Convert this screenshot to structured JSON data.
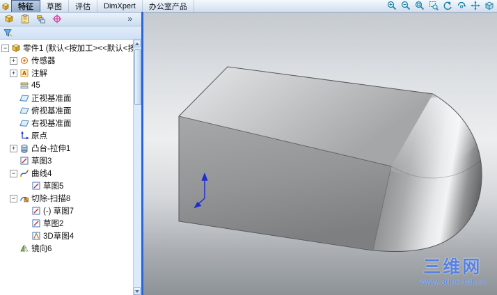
{
  "header": {
    "tabs": [
      {
        "label": "特征"
      },
      {
        "label": "草图"
      },
      {
        "label": "评估"
      },
      {
        "label": "DimXpert"
      },
      {
        "label": "办公室产品"
      }
    ],
    "active_tab": "特征",
    "view_tools": [
      {
        "name": "zoom-in"
      },
      {
        "name": "zoom-out"
      },
      {
        "name": "zoom-to-fit"
      },
      {
        "name": "zoom-to-area"
      },
      {
        "name": "previous-view"
      },
      {
        "name": "rotate-view"
      },
      {
        "name": "pan-view"
      },
      {
        "name": "view-orientation"
      }
    ]
  },
  "panel": {
    "manager_tabs": [
      {
        "name": "featuremanager-design-tree"
      },
      {
        "name": "propertymanager"
      },
      {
        "name": "configurationmanager"
      },
      {
        "name": "dimxpertmanager"
      }
    ],
    "more_chevron": "»",
    "filter": {
      "icon": "filter-funnel"
    },
    "tree": {
      "items": [
        {
          "label": "零件1 (默认<按加工><<默认<按",
          "icon": "part",
          "level": 0,
          "expander": "minus"
        },
        {
          "label": "传感器",
          "icon": "sensors",
          "level": 1,
          "expander": "plus"
        },
        {
          "label": "注解",
          "icon": "annotations",
          "level": 1,
          "expander": "plus"
        },
        {
          "label": "45",
          "icon": "material",
          "level": 1,
          "expander": "none"
        },
        {
          "label": "正视基准面",
          "icon": "plane",
          "level": 1,
          "expander": "none"
        },
        {
          "label": "俯视基准面",
          "icon": "plane",
          "level": 1,
          "expander": "none"
        },
        {
          "label": "右视基准面",
          "icon": "plane",
          "level": 1,
          "expander": "none"
        },
        {
          "label": "原点",
          "icon": "origin",
          "level": 1,
          "expander": "none"
        },
        {
          "label": "凸台-拉伸1",
          "icon": "boss-extrude",
          "level": 1,
          "expander": "plus"
        },
        {
          "label": "草图3",
          "icon": "sketch",
          "level": 1,
          "expander": "none"
        },
        {
          "label": "曲线4",
          "icon": "curve",
          "level": 1,
          "expander": "minus"
        },
        {
          "label": "草图5",
          "icon": "sketch",
          "level": 2,
          "expander": "none"
        },
        {
          "label": "切除-扫描8",
          "icon": "cut-sweep",
          "level": 1,
          "expander": "minus"
        },
        {
          "label": "(-) 草图7",
          "icon": "sketch",
          "level": 2,
          "expander": "none"
        },
        {
          "label": "草图2",
          "icon": "sketch",
          "level": 2,
          "expander": "none"
        },
        {
          "label": "3D草图4",
          "icon": "3d-sketch",
          "level": 2,
          "expander": "none"
        },
        {
          "label": "镜向6",
          "icon": "mirror",
          "level": 1,
          "expander": "none"
        }
      ]
    }
  },
  "watermark": {
    "title": "三维网",
    "url": "www.3dportal.cn"
  },
  "colors": {
    "splitter_blue": "#2b63d9",
    "watermark_blue": "#4f7fe8",
    "tabbar_bg": "#d2deee"
  }
}
